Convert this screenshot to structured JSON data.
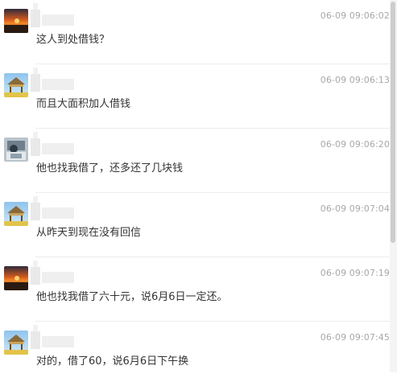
{
  "messages": [
    {
      "time": "06-09 09:06:02",
      "text": "这人到处借钱？",
      "avatar": "sunset-avatar"
    },
    {
      "time": "06-09 09:06:13",
      "text": "而且大面积加人借钱",
      "avatar": "pavilion-avatar"
    },
    {
      "time": "06-09 09:06:20",
      "text": "他也找我借了，还多还了几块钱",
      "avatar": "photo-avatar"
    },
    {
      "time": "06-09 09:07:04",
      "text": "从昨天到现在没有回信",
      "avatar": "pavilion-avatar"
    },
    {
      "time": "06-09 09:07:19",
      "text": "他也找我借了六十元，说6月6日一定还。",
      "avatar": "sunset-avatar"
    },
    {
      "time": "06-09 09:07:45",
      "text": "对的，借了60，说6月6日下午换",
      "avatar": "pavilion-avatar"
    }
  ],
  "colors": {
    "timestamp": "#a8a8a8",
    "message_text": "#333333",
    "divider": "#ececec"
  }
}
